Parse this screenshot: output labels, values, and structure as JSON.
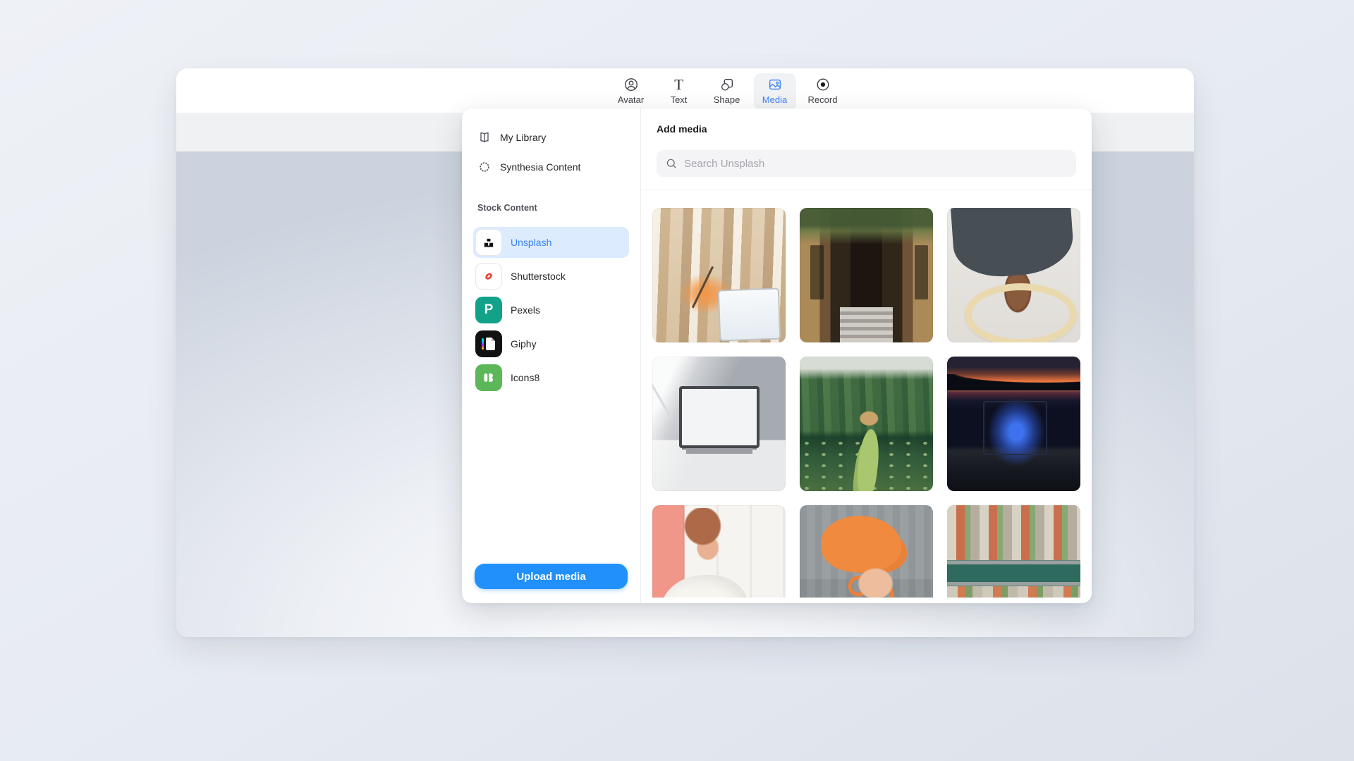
{
  "toolbar": {
    "tabs": [
      {
        "label": "Avatar",
        "icon": "avatar-icon",
        "active": false
      },
      {
        "label": "Text",
        "icon": "text-icon",
        "active": false
      },
      {
        "label": "Shape",
        "icon": "shape-icon",
        "active": false
      },
      {
        "label": "Media",
        "icon": "media-icon",
        "active": true
      },
      {
        "label": "Record",
        "icon": "record-icon",
        "active": false
      }
    ]
  },
  "icon_glyphs": {
    "text_tab": "T",
    "pexels": "P"
  },
  "panel": {
    "nav_items": [
      {
        "label": "My Library",
        "icon": "book-icon"
      },
      {
        "label": "Synthesia Content",
        "icon": "synthesia-logo-icon"
      }
    ],
    "stock_section": {
      "header": "Stock Content",
      "items": [
        {
          "label": "Unsplash",
          "selected": true,
          "tile_color": "#FFFFFF"
        },
        {
          "label": "Shutterstock",
          "selected": false,
          "tile_color": "#FFFFFF"
        },
        {
          "label": "Pexels",
          "selected": false,
          "tile_color": "#12A189"
        },
        {
          "label": "Giphy",
          "selected": false,
          "tile_color": "#121212"
        },
        {
          "label": "Icons8",
          "selected": false,
          "tile_color": "#5CB758"
        }
      ]
    },
    "upload_button": "Upload media",
    "content": {
      "title": "Add media",
      "search_placeholder": "Search Unsplash",
      "photos": [
        {
          "desc": "warm office interior with stone pillars, orange desk lamp and monitor",
          "palette": [
            "#DFCCB1",
            "#C9AF8C",
            "#F29646"
          ]
        },
        {
          "desc": "ornate building entrance with greenery above a dark door and steps",
          "palette": [
            "#465C36",
            "#AB8A58",
            "#1D1510"
          ]
        },
        {
          "desc": "person in dark coat and brown boots standing on coiled cream rope",
          "palette": [
            "#474F55",
            "#8A5A3C",
            "#EAD9AE"
          ]
        },
        {
          "desc": "white desk with computer monitor lit by a lamp",
          "palette": [
            "#A6ABB1",
            "#F2F4F6",
            "#E8E9EA"
          ]
        },
        {
          "desc": "tropical garden with lily pond, winding green path and palm trees",
          "palette": [
            "#3F6E4B",
            "#A9C76F",
            "#D7DCD4"
          ]
        },
        {
          "desc": "laptop glowing blue at dusk with an orange sunset horizon",
          "palette": [
            "#0D1020",
            "#4076F8",
            "#F29A55"
          ]
        },
        {
          "desc": "woman with auburn hair in white blouse against a pink wall",
          "palette": [
            "#F0978A",
            "#F6F4F1",
            "#AE6A48"
          ]
        },
        {
          "desc": "person wearing an orange beret and orange sunglasses",
          "palette": [
            "#EF8A3F",
            "#9AA0A3",
            "#EEBD9D"
          ]
        },
        {
          "desc": "aerial view of houses with orange roofs along a teal canal",
          "palette": [
            "#2F6A5F",
            "#C96F4C",
            "#87A871"
          ]
        }
      ]
    }
  },
  "colors": {
    "accent": "#3B82F6",
    "selected_row_bg": "#DCEBFE",
    "upload_button": "#2190FA",
    "panel_bg": "#FFFFFF",
    "canvas_strip": "#F0F1F2",
    "avatar_skin_coral": "#F2998A"
  }
}
